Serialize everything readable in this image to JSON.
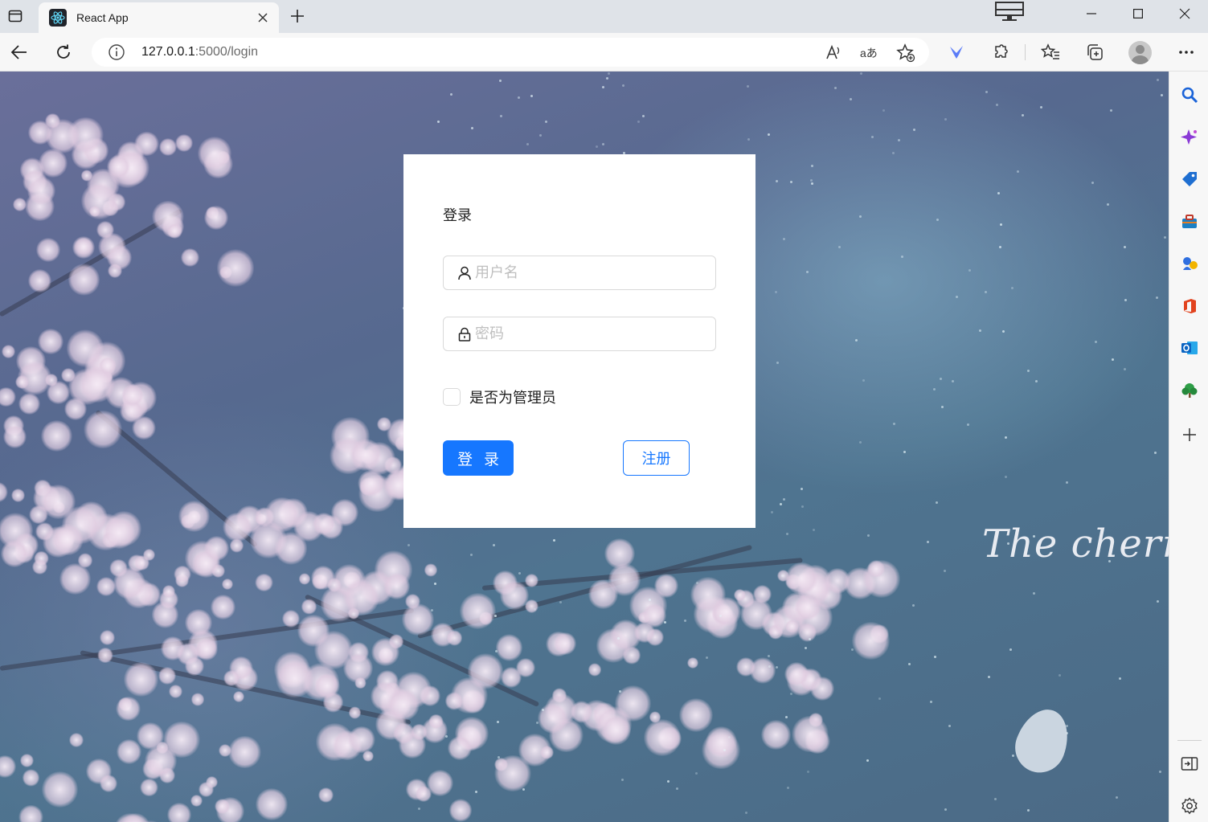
{
  "browser": {
    "tab_title": "React App",
    "url_host": "127.0.0.1",
    "url_rest": ":5000/login",
    "icons": {
      "tab_actions": "tab-actions-icon",
      "favicon": "react-logo-icon",
      "close_tab": "close-icon",
      "new_tab": "plus-icon",
      "back": "back-arrow-icon",
      "refresh": "refresh-icon",
      "site_info": "info-icon",
      "read_aloud": "read-aloud-icon",
      "translate": "translate-icon",
      "add_favorite": "star-add-icon",
      "extension_blue": "bluebird-extension-icon",
      "extensions": "puzzle-icon",
      "favorites": "favorites-icon",
      "collections": "collections-icon",
      "profile": "avatar",
      "menu": "more-icon"
    }
  },
  "sidebar": {
    "items": [
      "search-icon",
      "copilot-sparkle-icon",
      "shopping-tag-icon",
      "tools-briefcase-icon",
      "games-icon",
      "office-icon",
      "outlook-icon",
      "tree-icon",
      "add-icon"
    ],
    "bottom": [
      "split-screen-icon",
      "settings-gear-icon"
    ]
  },
  "background": {
    "script_text": "The cherry"
  },
  "login": {
    "title": "登录",
    "username_placeholder": "用户名",
    "password_placeholder": "密码",
    "admin_checkbox_label": "是否为管理员",
    "login_button": "登 录",
    "register_button": "注册",
    "primary_color": "#1677ff"
  }
}
